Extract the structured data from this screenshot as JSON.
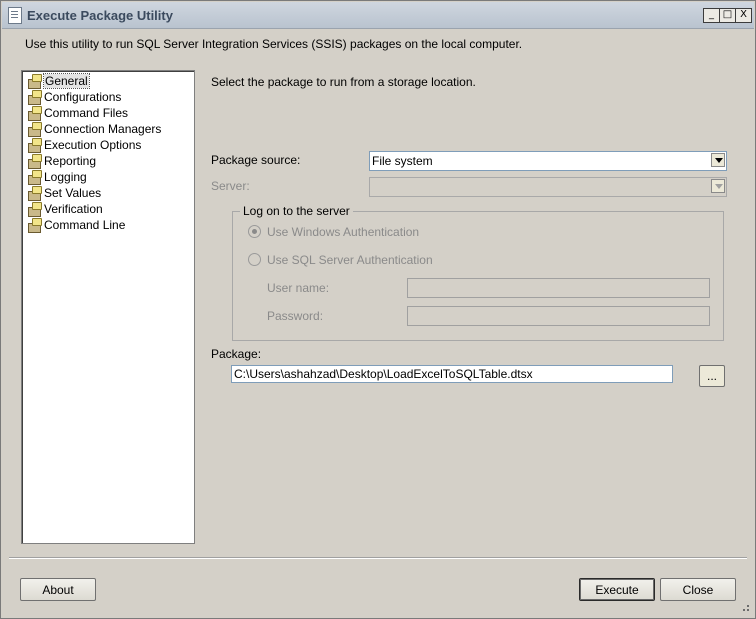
{
  "window": {
    "title": "Execute Package Utility",
    "controls": {
      "minimize": "_",
      "maximize": "□",
      "close": "X"
    }
  },
  "description": "Use this utility to run SQL Server Integration Services (SSIS) packages on the local computer.",
  "nav": {
    "items": [
      {
        "label": "General",
        "icon": "package-icon",
        "selected": true
      },
      {
        "label": "Configurations",
        "icon": "package-icon"
      },
      {
        "label": "Command Files",
        "icon": "package-icon"
      },
      {
        "label": "Connection Managers",
        "icon": "package-icon"
      },
      {
        "label": "Execution Options",
        "icon": "package-icon"
      },
      {
        "label": "Reporting",
        "icon": "package-icon"
      },
      {
        "label": "Logging",
        "icon": "package-icon"
      },
      {
        "label": "Set Values",
        "icon": "package-icon"
      },
      {
        "label": "Verification",
        "icon": "package-icon"
      },
      {
        "label": "Command Line",
        "icon": "package-icon"
      }
    ]
  },
  "general": {
    "description": "Select the package to run from a storage location.",
    "package_source_label": "Package source:",
    "package_source_value": "File system",
    "server_label": "Server:",
    "server_value": "",
    "logon_group_title": "Log on to the server",
    "windows_auth_label": "Use Windows Authentication",
    "sql_auth_label": "Use SQL Server Authentication",
    "username_label": "User name:",
    "password_label": "Password:",
    "package_label": "Package:",
    "package_value": "C:\\Users\\ashahzad\\Desktop\\LoadExcelToSQLTable.dtsx",
    "browse_label": "..."
  },
  "buttons": {
    "about": "About",
    "execute": "Execute",
    "close": "Close"
  },
  "colors": {
    "window_bg": "#d4d0c8",
    "titlebar": "#c3cbd6",
    "disabled_text": "#8a8a8a"
  }
}
